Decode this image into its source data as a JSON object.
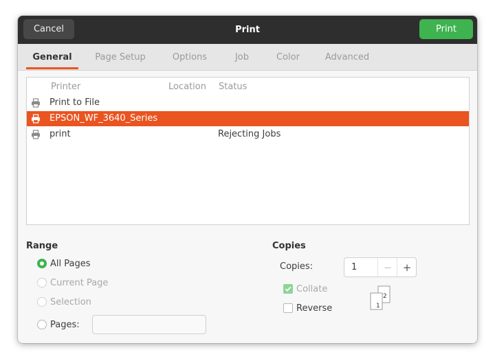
{
  "titlebar": {
    "cancel_label": "Cancel",
    "title": "Print",
    "print_label": "Print"
  },
  "tabs": [
    {
      "label": "General",
      "active": true
    },
    {
      "label": "Page Setup",
      "active": false
    },
    {
      "label": "Options",
      "active": false
    },
    {
      "label": "Job",
      "active": false
    },
    {
      "label": "Color",
      "active": false
    },
    {
      "label": "Advanced",
      "active": false
    }
  ],
  "printer_list": {
    "columns": [
      "Printer",
      "Location",
      "Status"
    ],
    "rows": [
      {
        "icon": "printer-icon",
        "name": "Print to File",
        "location": "",
        "status": "",
        "selected": false
      },
      {
        "icon": "printer-icon",
        "name": "EPSON_WF_3640_Series",
        "location": "",
        "status": "",
        "selected": true
      },
      {
        "icon": "printer-icon",
        "name": "print",
        "location": "",
        "status": "Rejecting Jobs",
        "selected": false
      }
    ]
  },
  "range": {
    "title": "Range",
    "options": [
      {
        "label": "All Pages",
        "checked": true,
        "enabled": true
      },
      {
        "label": "Current Page",
        "checked": false,
        "enabled": false
      },
      {
        "label": "Selection",
        "checked": false,
        "enabled": false
      },
      {
        "label": "Pages:",
        "checked": false,
        "enabled": true
      }
    ],
    "pages_value": ""
  },
  "copies": {
    "title": "Copies",
    "copies_label": "Copies:",
    "copies_value": "1",
    "minus_symbol": "−",
    "plus_symbol": "+",
    "collate_label": "Collate",
    "collate_checked": true,
    "collate_enabled": false,
    "reverse_label": "Reverse",
    "reverse_checked": false,
    "collate_page_front": "1",
    "collate_page_back": "2"
  },
  "colors": {
    "accent": "#e95420",
    "print_button": "#3eb34f",
    "titlebar": "#2e2e2e"
  }
}
